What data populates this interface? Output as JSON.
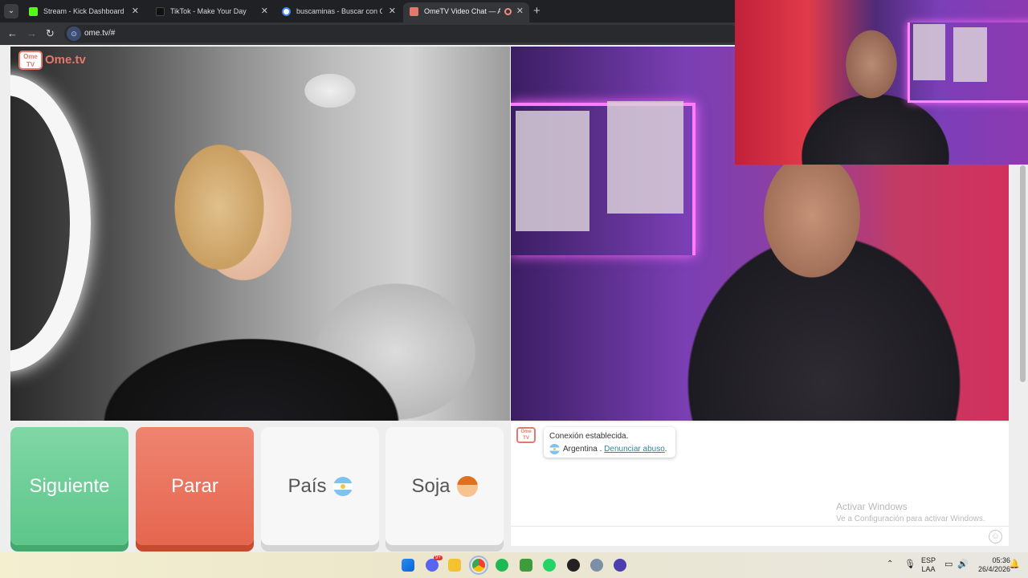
{
  "browser": {
    "tabs": [
      {
        "label": "Stream - Kick Dashboard",
        "favicon": "kick-icon",
        "color": "#53fc18"
      },
      {
        "label": "TikTok - Make Your Day",
        "favicon": "tiktok-icon",
        "color": "#111111"
      },
      {
        "label": "buscaminas - Buscar con Google",
        "favicon": "google-icon",
        "color": "#4285f4"
      },
      {
        "label": "OmeTV Video Chat — Alternat",
        "favicon": "ometv-icon",
        "color": "#e4786b",
        "active": true
      }
    ],
    "new_tab": "+",
    "url": "ome.tv/#"
  },
  "app": {
    "logo_text": "Ome.tv",
    "logo_badge": "Ome TV",
    "brand_color": "#e4786b"
  },
  "controls": {
    "next": "Siguiente",
    "stop": "Parar",
    "country": "País",
    "gender": "Soja"
  },
  "chat": {
    "status": "Conexión establecida.",
    "country": "Argentina",
    "separator": " . ",
    "report_link": "Denunciar abuso",
    "period": "."
  },
  "watermark": {
    "title": "Activar Windows",
    "subtitle": "Ve a Configuración para activar Windows."
  },
  "taskbar": {
    "lang": "ESP",
    "lang_sub": "LAA",
    "time": "05:36",
    "date": "26/4/2026",
    "discord_badge": "9+"
  }
}
